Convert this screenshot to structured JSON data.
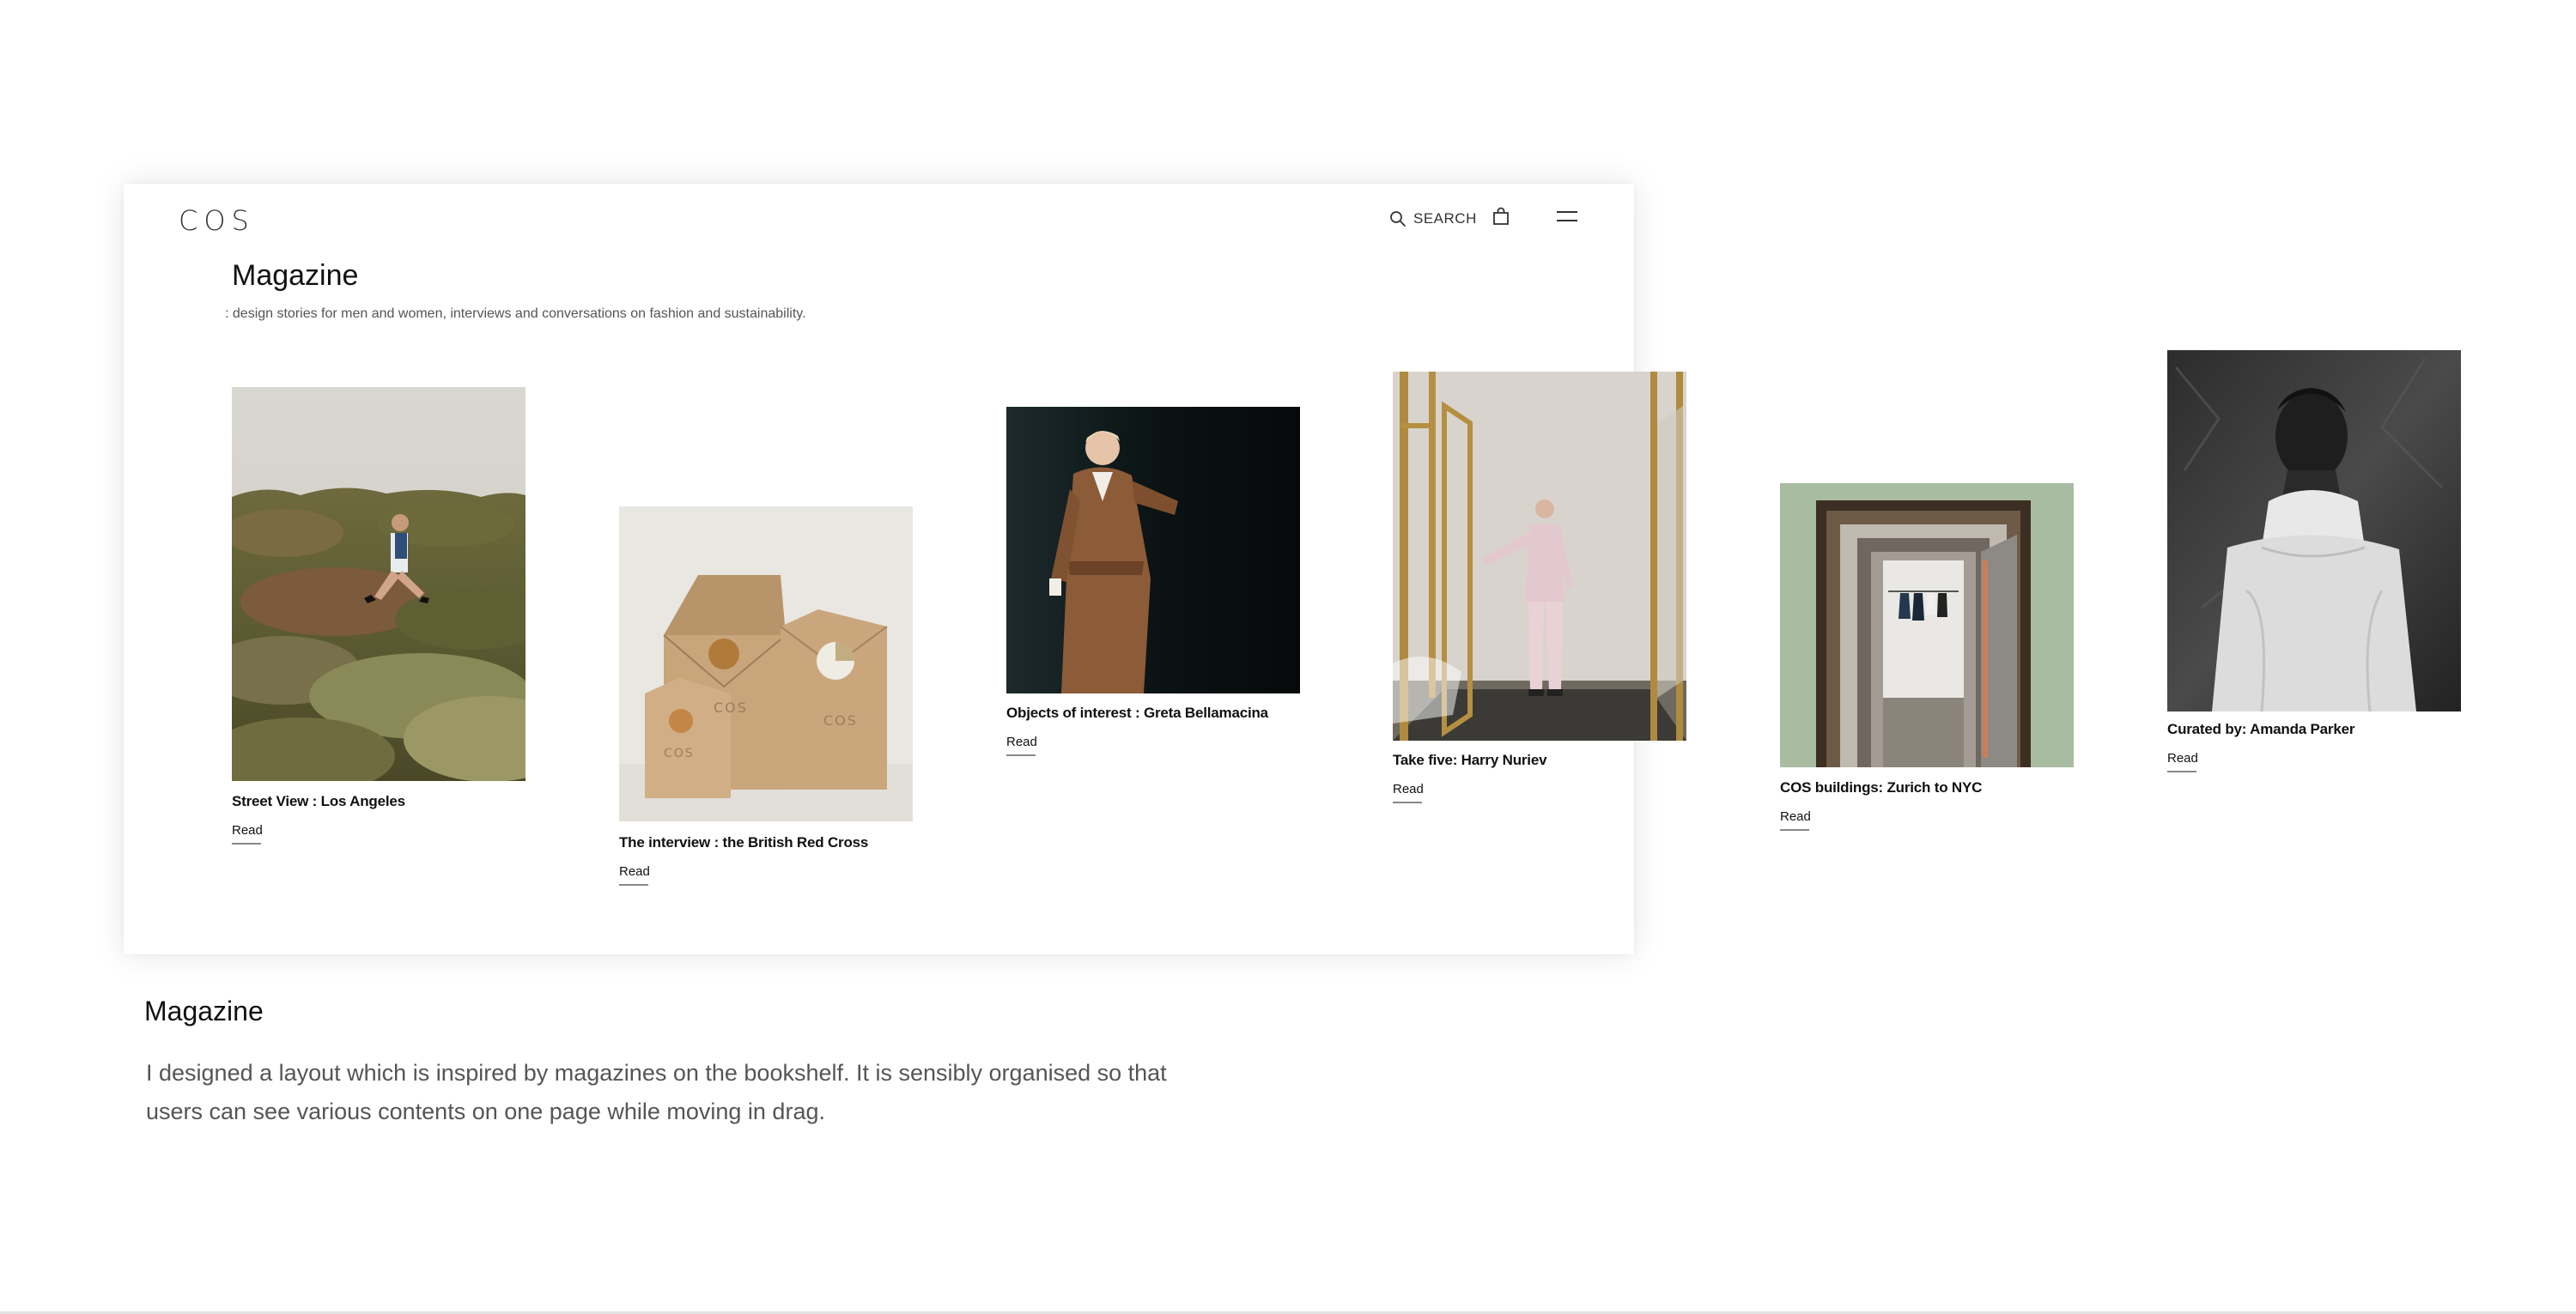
{
  "header": {
    "logo": "COS",
    "search_label": "SEARCH"
  },
  "page": {
    "title": "Magazine",
    "description": ": design stories for men and women, interviews and conversations on fashion and sustainability."
  },
  "articles": [
    {
      "title": "Street View : Los Angeles",
      "read_label": "Read"
    },
    {
      "title": "The interview : the British Red Cross",
      "read_label": "Read"
    },
    {
      "title": "Objects of interest : Greta Bellamacina",
      "read_label": "Read"
    },
    {
      "title": "Take five: Harry Nuriev",
      "read_label": "Read"
    },
    {
      "title": "COS buildings: Zurich to NYC",
      "read_label": "Read"
    },
    {
      "title": "Curated by: Amanda Parker",
      "read_label": "Read"
    }
  ],
  "caption": {
    "heading": "Magazine",
    "body": "I designed a layout which is inspired by magazines on the bookshelf. It is sensibly organised so that users can see various contents on one page while moving in drag."
  },
  "colors": {
    "text_primary": "#111111",
    "text_secondary": "#555555",
    "underline": "#888888",
    "background": "#ffffff"
  }
}
